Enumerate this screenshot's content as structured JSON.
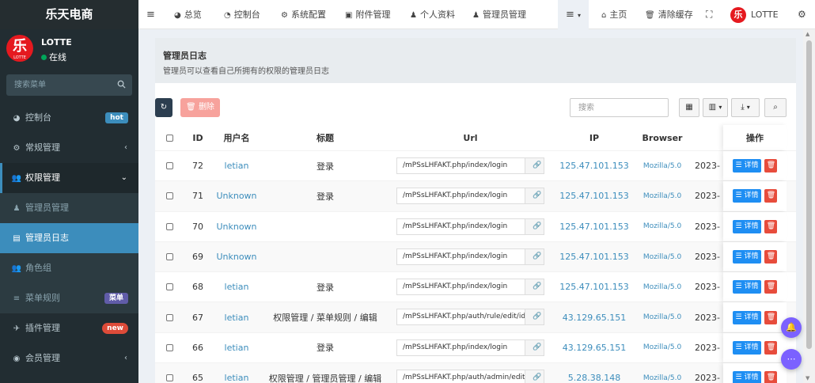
{
  "app": {
    "brand": "乐天电商",
    "user": "LOTTE",
    "status": "在线",
    "avatar_char": "乐",
    "avatar_sub": "LOTTE"
  },
  "sidebar": {
    "search_placeholder": "搜索菜单",
    "items": [
      {
        "label": "控制台",
        "badge": "hot"
      },
      {
        "label": "常规管理"
      },
      {
        "label": "权限管理"
      },
      {
        "label": "管理员管理"
      },
      {
        "label": "管理员日志"
      },
      {
        "label": "角色组"
      },
      {
        "label": "菜单规则",
        "badge": "菜单"
      },
      {
        "label": "插件管理",
        "badge": "new"
      },
      {
        "label": "会员管理"
      }
    ]
  },
  "topbar": {
    "items": [
      "总览",
      "控制台",
      "系统配置",
      "附件管理",
      "个人资料",
      "管理员管理"
    ],
    "home": "主页",
    "clear_cache": "清除缓存",
    "user": "LOTTE"
  },
  "panel": {
    "title": "管理员日志",
    "desc": "管理员可以查看自己所拥有的权限的管理员日志"
  },
  "toolbar": {
    "delete_label": "删除",
    "search_placeholder": "搜索"
  },
  "table": {
    "headers": {
      "id": "ID",
      "username": "用户名",
      "title": "标题",
      "url": "Url",
      "ip": "IP",
      "browser": "Browser",
      "action": "操作"
    },
    "detail_label": "详情",
    "rows": [
      {
        "id": "72",
        "user": "letian",
        "title": "登录",
        "url": "/mPSsLHFAKT.php/index/login",
        "ip": "125.47.101.153",
        "browser": "Mozilla/5.0",
        "time": "2023-"
      },
      {
        "id": "71",
        "user": "Unknown",
        "title": "登录",
        "url": "/mPSsLHFAKT.php/index/login",
        "ip": "125.47.101.153",
        "browser": "Mozilla/5.0",
        "time": "2023-"
      },
      {
        "id": "70",
        "user": "Unknown",
        "title": "",
        "url": "/mPSsLHFAKT.php/index/login",
        "ip": "125.47.101.153",
        "browser": "Mozilla/5.0",
        "time": "2023-"
      },
      {
        "id": "69",
        "user": "Unknown",
        "title": "",
        "url": "/mPSsLHFAKT.php/index/login",
        "ip": "125.47.101.153",
        "browser": "Mozilla/5.0",
        "time": "2023-"
      },
      {
        "id": "68",
        "user": "letian",
        "title": "登录",
        "url": "/mPSsLHFAKT.php/index/login",
        "ip": "125.47.101.153",
        "browser": "Mozilla/5.0",
        "time": "2023-"
      },
      {
        "id": "67",
        "user": "letian",
        "title": "权限管理 / 菜单规则 / 编辑",
        "url": "/mPSsLHFAKT.php/auth/rule/edit/ids",
        "ip": "43.129.65.151",
        "browser": "Mozilla/5.0",
        "time": "2023-"
      },
      {
        "id": "66",
        "user": "letian",
        "title": "登录",
        "url": "/mPSsLHFAKT.php/index/login",
        "ip": "43.129.65.151",
        "browser": "Mozilla/5.0",
        "time": "2023-"
      },
      {
        "id": "65",
        "user": "letian",
        "title": "权限管理 / 管理员管理 / 编辑",
        "url": "/mPSsLHFAKT.php/auth/admin/edit/",
        "ip": "5.28.38.148",
        "browser": "Mozilla/5.0",
        "time": "2023-"
      }
    ]
  },
  "colors": {
    "primary": "#3c8dbc",
    "sidebar": "#222d32",
    "danger": "#e74c3c",
    "detail": "#1e8ef3",
    "accent": "#7b61ff"
  }
}
